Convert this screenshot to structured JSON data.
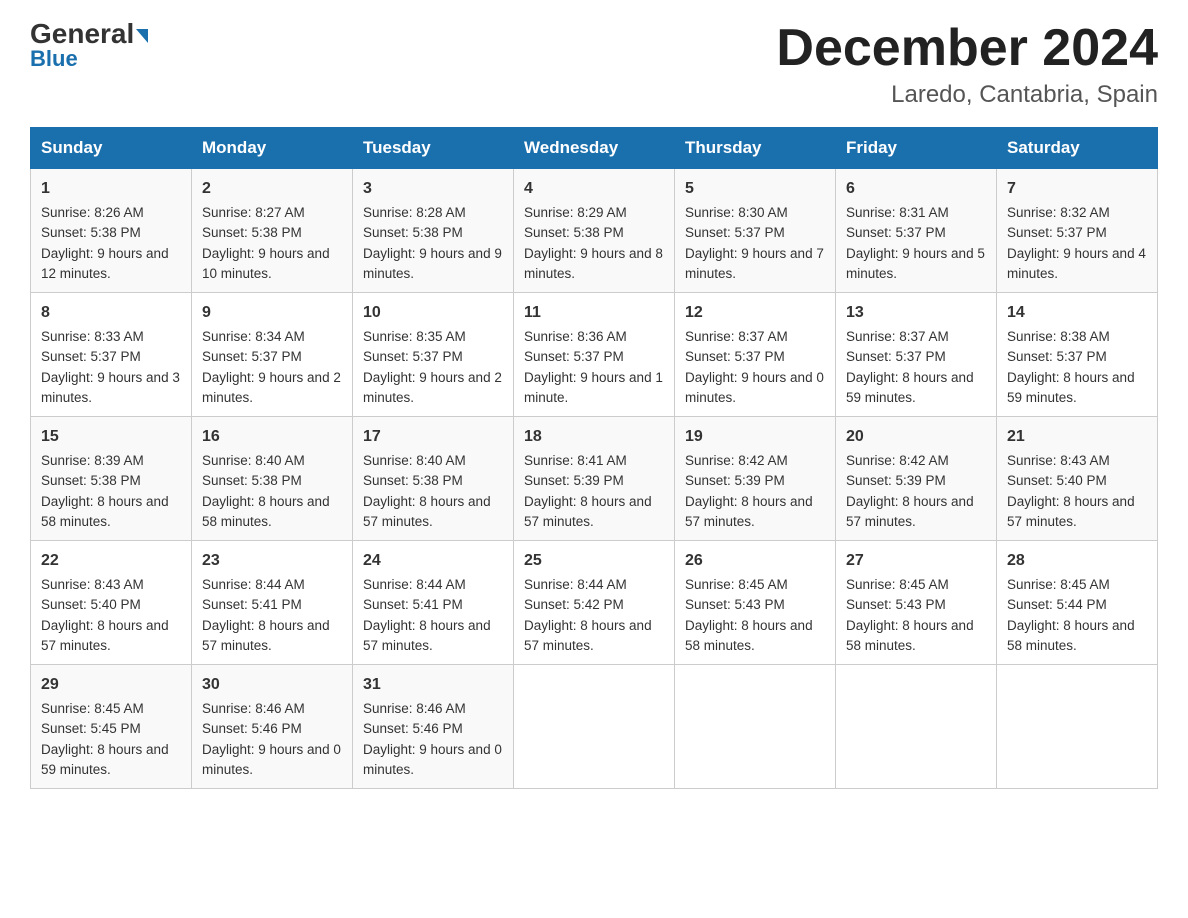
{
  "header": {
    "logo_general": "General",
    "logo_blue": "Blue",
    "month_title": "December 2024",
    "location": "Laredo, Cantabria, Spain"
  },
  "days_of_week": [
    "Sunday",
    "Monday",
    "Tuesday",
    "Wednesday",
    "Thursday",
    "Friday",
    "Saturday"
  ],
  "weeks": [
    [
      {
        "day": "1",
        "sunrise": "Sunrise: 8:26 AM",
        "sunset": "Sunset: 5:38 PM",
        "daylight": "Daylight: 9 hours and 12 minutes."
      },
      {
        "day": "2",
        "sunrise": "Sunrise: 8:27 AM",
        "sunset": "Sunset: 5:38 PM",
        "daylight": "Daylight: 9 hours and 10 minutes."
      },
      {
        "day": "3",
        "sunrise": "Sunrise: 8:28 AM",
        "sunset": "Sunset: 5:38 PM",
        "daylight": "Daylight: 9 hours and 9 minutes."
      },
      {
        "day": "4",
        "sunrise": "Sunrise: 8:29 AM",
        "sunset": "Sunset: 5:38 PM",
        "daylight": "Daylight: 9 hours and 8 minutes."
      },
      {
        "day": "5",
        "sunrise": "Sunrise: 8:30 AM",
        "sunset": "Sunset: 5:37 PM",
        "daylight": "Daylight: 9 hours and 7 minutes."
      },
      {
        "day": "6",
        "sunrise": "Sunrise: 8:31 AM",
        "sunset": "Sunset: 5:37 PM",
        "daylight": "Daylight: 9 hours and 5 minutes."
      },
      {
        "day": "7",
        "sunrise": "Sunrise: 8:32 AM",
        "sunset": "Sunset: 5:37 PM",
        "daylight": "Daylight: 9 hours and 4 minutes."
      }
    ],
    [
      {
        "day": "8",
        "sunrise": "Sunrise: 8:33 AM",
        "sunset": "Sunset: 5:37 PM",
        "daylight": "Daylight: 9 hours and 3 minutes."
      },
      {
        "day": "9",
        "sunrise": "Sunrise: 8:34 AM",
        "sunset": "Sunset: 5:37 PM",
        "daylight": "Daylight: 9 hours and 2 minutes."
      },
      {
        "day": "10",
        "sunrise": "Sunrise: 8:35 AM",
        "sunset": "Sunset: 5:37 PM",
        "daylight": "Daylight: 9 hours and 2 minutes."
      },
      {
        "day": "11",
        "sunrise": "Sunrise: 8:36 AM",
        "sunset": "Sunset: 5:37 PM",
        "daylight": "Daylight: 9 hours and 1 minute."
      },
      {
        "day": "12",
        "sunrise": "Sunrise: 8:37 AM",
        "sunset": "Sunset: 5:37 PM",
        "daylight": "Daylight: 9 hours and 0 minutes."
      },
      {
        "day": "13",
        "sunrise": "Sunrise: 8:37 AM",
        "sunset": "Sunset: 5:37 PM",
        "daylight": "Daylight: 8 hours and 59 minutes."
      },
      {
        "day": "14",
        "sunrise": "Sunrise: 8:38 AM",
        "sunset": "Sunset: 5:37 PM",
        "daylight": "Daylight: 8 hours and 59 minutes."
      }
    ],
    [
      {
        "day": "15",
        "sunrise": "Sunrise: 8:39 AM",
        "sunset": "Sunset: 5:38 PM",
        "daylight": "Daylight: 8 hours and 58 minutes."
      },
      {
        "day": "16",
        "sunrise": "Sunrise: 8:40 AM",
        "sunset": "Sunset: 5:38 PM",
        "daylight": "Daylight: 8 hours and 58 minutes."
      },
      {
        "day": "17",
        "sunrise": "Sunrise: 8:40 AM",
        "sunset": "Sunset: 5:38 PM",
        "daylight": "Daylight: 8 hours and 57 minutes."
      },
      {
        "day": "18",
        "sunrise": "Sunrise: 8:41 AM",
        "sunset": "Sunset: 5:39 PM",
        "daylight": "Daylight: 8 hours and 57 minutes."
      },
      {
        "day": "19",
        "sunrise": "Sunrise: 8:42 AM",
        "sunset": "Sunset: 5:39 PM",
        "daylight": "Daylight: 8 hours and 57 minutes."
      },
      {
        "day": "20",
        "sunrise": "Sunrise: 8:42 AM",
        "sunset": "Sunset: 5:39 PM",
        "daylight": "Daylight: 8 hours and 57 minutes."
      },
      {
        "day": "21",
        "sunrise": "Sunrise: 8:43 AM",
        "sunset": "Sunset: 5:40 PM",
        "daylight": "Daylight: 8 hours and 57 minutes."
      }
    ],
    [
      {
        "day": "22",
        "sunrise": "Sunrise: 8:43 AM",
        "sunset": "Sunset: 5:40 PM",
        "daylight": "Daylight: 8 hours and 57 minutes."
      },
      {
        "day": "23",
        "sunrise": "Sunrise: 8:44 AM",
        "sunset": "Sunset: 5:41 PM",
        "daylight": "Daylight: 8 hours and 57 minutes."
      },
      {
        "day": "24",
        "sunrise": "Sunrise: 8:44 AM",
        "sunset": "Sunset: 5:41 PM",
        "daylight": "Daylight: 8 hours and 57 minutes."
      },
      {
        "day": "25",
        "sunrise": "Sunrise: 8:44 AM",
        "sunset": "Sunset: 5:42 PM",
        "daylight": "Daylight: 8 hours and 57 minutes."
      },
      {
        "day": "26",
        "sunrise": "Sunrise: 8:45 AM",
        "sunset": "Sunset: 5:43 PM",
        "daylight": "Daylight: 8 hours and 58 minutes."
      },
      {
        "day": "27",
        "sunrise": "Sunrise: 8:45 AM",
        "sunset": "Sunset: 5:43 PM",
        "daylight": "Daylight: 8 hours and 58 minutes."
      },
      {
        "day": "28",
        "sunrise": "Sunrise: 8:45 AM",
        "sunset": "Sunset: 5:44 PM",
        "daylight": "Daylight: 8 hours and 58 minutes."
      }
    ],
    [
      {
        "day": "29",
        "sunrise": "Sunrise: 8:45 AM",
        "sunset": "Sunset: 5:45 PM",
        "daylight": "Daylight: 8 hours and 59 minutes."
      },
      {
        "day": "30",
        "sunrise": "Sunrise: 8:46 AM",
        "sunset": "Sunset: 5:46 PM",
        "daylight": "Daylight: 9 hours and 0 minutes."
      },
      {
        "day": "31",
        "sunrise": "Sunrise: 8:46 AM",
        "sunset": "Sunset: 5:46 PM",
        "daylight": "Daylight: 9 hours and 0 minutes."
      },
      null,
      null,
      null,
      null
    ]
  ]
}
